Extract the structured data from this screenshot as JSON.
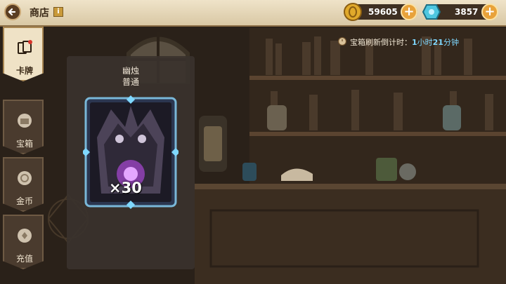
{
  "header": {
    "title": "商店",
    "info_icon": "i"
  },
  "currency": {
    "gold": {
      "icon": "gold-coin-icon",
      "value": "59605"
    },
    "gem": {
      "icon": "blue-gem-icon",
      "value": "3857"
    }
  },
  "sidebar": {
    "tabs": [
      {
        "label": "卡牌",
        "icon": "cards-icon",
        "active": true
      },
      {
        "label": "宝箱",
        "icon": "chest-icon",
        "active": false
      },
      {
        "label": "金币",
        "icon": "coin-icon",
        "active": false
      },
      {
        "label": "充值",
        "icon": "recharge-icon",
        "active": false
      }
    ]
  },
  "timer": {
    "label": "宝箱刷新倒计时：",
    "hours": "1",
    "hours_unit": "小时",
    "minutes": "21",
    "minutes_unit": "分钟"
  },
  "card": {
    "name": "幽烛",
    "rarity": "普通",
    "quantity": "×30"
  },
  "colors": {
    "accent": "#e8a23a",
    "highlight": "#7fd8ff",
    "header_bg": "#e4d5b5"
  }
}
